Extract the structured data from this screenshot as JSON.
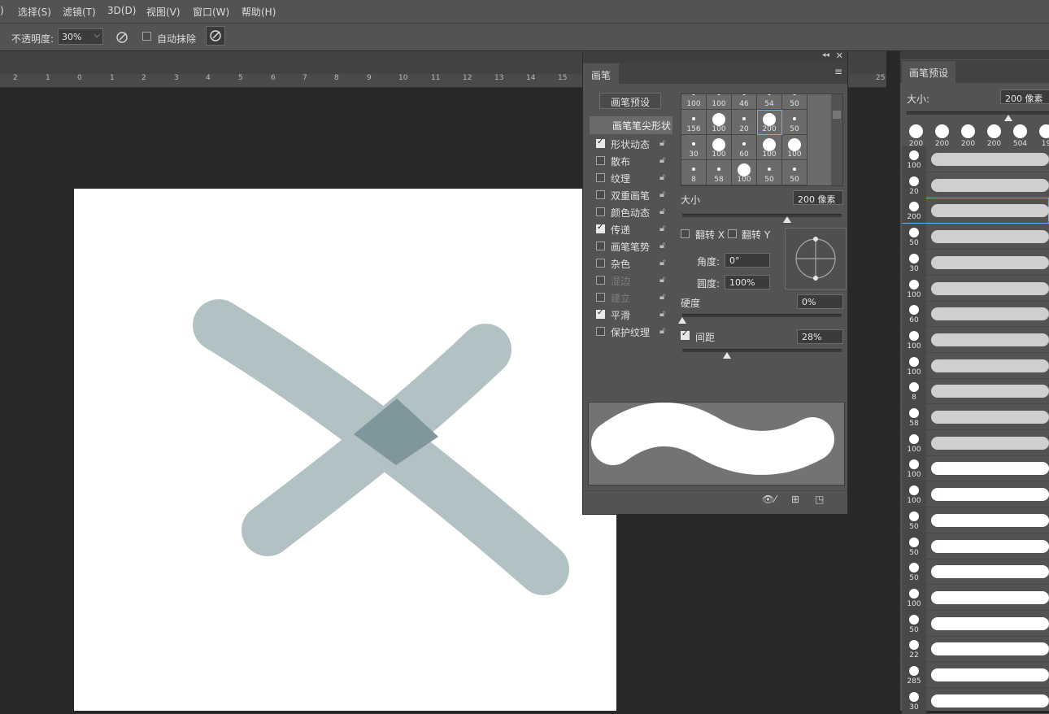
{
  "menu": {
    "items": [
      ")",
      "选择(S)",
      "滤镜(T)",
      "3D(D)",
      "视图(V)",
      "窗口(W)",
      "帮助(H)"
    ]
  },
  "options": {
    "opacity_label": "不透明度:",
    "opacity_value": "30%",
    "auto_erase_label": "自动抹除"
  },
  "ruler": {
    "ticks": [
      "2",
      "1",
      "0",
      "1",
      "2",
      "3",
      "4",
      "5",
      "6",
      "7",
      "8",
      "9",
      "10",
      "11",
      "12",
      "13",
      "14",
      "15",
      "16",
      "25"
    ]
  },
  "brush_panel": {
    "tab": "画笔",
    "preset_button": "画笔预设",
    "tip_shape_header": "画笔笔尖形状",
    "options": [
      {
        "label": "形状动态",
        "checked": true,
        "dim": false
      },
      {
        "label": "散布",
        "checked": false,
        "dim": false
      },
      {
        "label": "纹理",
        "checked": false,
        "dim": false
      },
      {
        "label": "双重画笔",
        "checked": false,
        "dim": false
      },
      {
        "label": "颜色动态",
        "checked": false,
        "dim": false
      },
      {
        "label": "传递",
        "checked": true,
        "dim": false
      },
      {
        "label": "画笔笔势",
        "checked": false,
        "dim": false
      },
      {
        "label": "杂色",
        "checked": false,
        "dim": false
      },
      {
        "label": "湿边",
        "checked": false,
        "dim": true
      },
      {
        "label": "建立",
        "checked": false,
        "dim": true
      },
      {
        "label": "平滑",
        "checked": true,
        "dim": false
      },
      {
        "label": "保护纹理",
        "checked": false,
        "dim": false
      }
    ],
    "tip_grid": [
      [
        "100",
        "100",
        "46",
        "54",
        "50"
      ],
      [
        "156",
        "100",
        "20",
        "200",
        "50"
      ],
      [
        "30",
        "100",
        "60",
        "100",
        "100"
      ],
      [
        "8",
        "58",
        "100",
        "50",
        "50"
      ]
    ],
    "size_label": "大小",
    "size_value": "200 像素",
    "flip_x_label": "翻转 X",
    "flip_y_label": "翻转 Y",
    "angle_label": "角度:",
    "angle_value": "0°",
    "roundness_label": "圆度:",
    "roundness_value": "100%",
    "hardness_label": "硬度",
    "hardness_value": "0%",
    "spacing_label": "间距",
    "spacing_value": "28%",
    "size_level": 0.66,
    "hardness_level": 0.0,
    "spacing_level": 0.28
  },
  "preset_panel": {
    "tab": "画笔预设",
    "size_label": "大小:",
    "size_value": "200 像素",
    "top_tips": [
      "200",
      "200",
      "200",
      "200",
      "504",
      "19"
    ],
    "rows": [
      "100",
      "20",
      "200",
      "50",
      "30",
      "100",
      "60",
      "100",
      "100",
      "8",
      "58",
      "100",
      "100",
      "100",
      "50",
      "50",
      "50",
      "100",
      "50",
      "22",
      "285",
      "30"
    ]
  }
}
